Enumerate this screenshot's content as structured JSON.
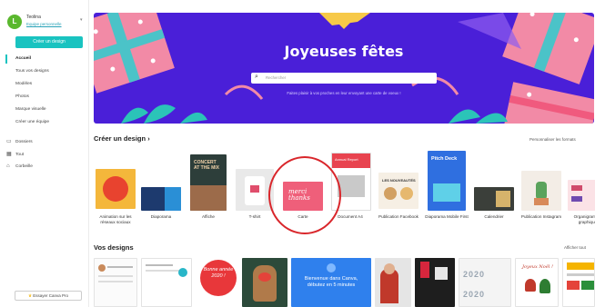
{
  "sidebar": {
    "profile_initial": "L",
    "profile_name": "Teolina",
    "profile_link": "Equipe personnelle",
    "create_button": "Créer un design",
    "nav": [
      "Accueil",
      "Tous vos designs",
      "Modèles",
      "Photos",
      "Marque visuelle",
      "Créer une équipe"
    ],
    "nav2": [
      {
        "icon": "folder-icon",
        "glyph": "▭",
        "label": "Dossiers"
      },
      {
        "icon": "grid-icon",
        "glyph": "▦",
        "label": "Tout"
      },
      {
        "icon": "trash-icon",
        "glyph": "🗑",
        "label": "Corbeille"
      }
    ],
    "pro_button": "Essayer Canva Pro"
  },
  "hero": {
    "title": "Joyeuses fêtes",
    "search_placeholder": "Rechercher",
    "hint": "Faites plaisir à vos proches en leur envoyant une carte de voeux !"
  },
  "create_section": {
    "title": "Créer un design",
    "chevron": "›",
    "link": "Personnaliser les formats"
  },
  "design_types": [
    {
      "label": "Animation sur les réseaux sociaux"
    },
    {
      "label": "Diaporama"
    },
    {
      "label": "Affiche",
      "thumb_text": "CONCERT AT THE MIX"
    },
    {
      "label": "T-shirt"
    },
    {
      "label": "Carte",
      "thumb_text": "merci thanks"
    },
    {
      "label": "Document A4",
      "thumb_text": "Annual Report"
    },
    {
      "label": "Publication Facebook",
      "thumb_text": "LES NOUVEAUTÉS"
    },
    {
      "label": "Diaporama Mobile First",
      "thumb_text": "Pitch Deck"
    },
    {
      "label": "Calendrier"
    },
    {
      "label": "Publication Instagram"
    },
    {
      "label": "Organigramme graphique"
    }
  ],
  "your_designs": {
    "title": "Vos designs",
    "link": "Afficher tout",
    "items": [
      {
        "text": ""
      },
      {
        "text": ""
      },
      {
        "text": "Bonne année 2020 !"
      },
      {
        "text": ""
      },
      {
        "text": "Bienvenue dans Canva, débutez en 5 minutes"
      },
      {
        "text": ""
      },
      {
        "text": ""
      },
      {
        "text": "2020 2020"
      },
      {
        "text": "Joyeux Noël !"
      },
      {
        "text": ""
      }
    ]
  },
  "colors": {
    "accent": "#19c3c0",
    "hero_bg": "#4a1fd8",
    "annotation": "#d9262b"
  }
}
